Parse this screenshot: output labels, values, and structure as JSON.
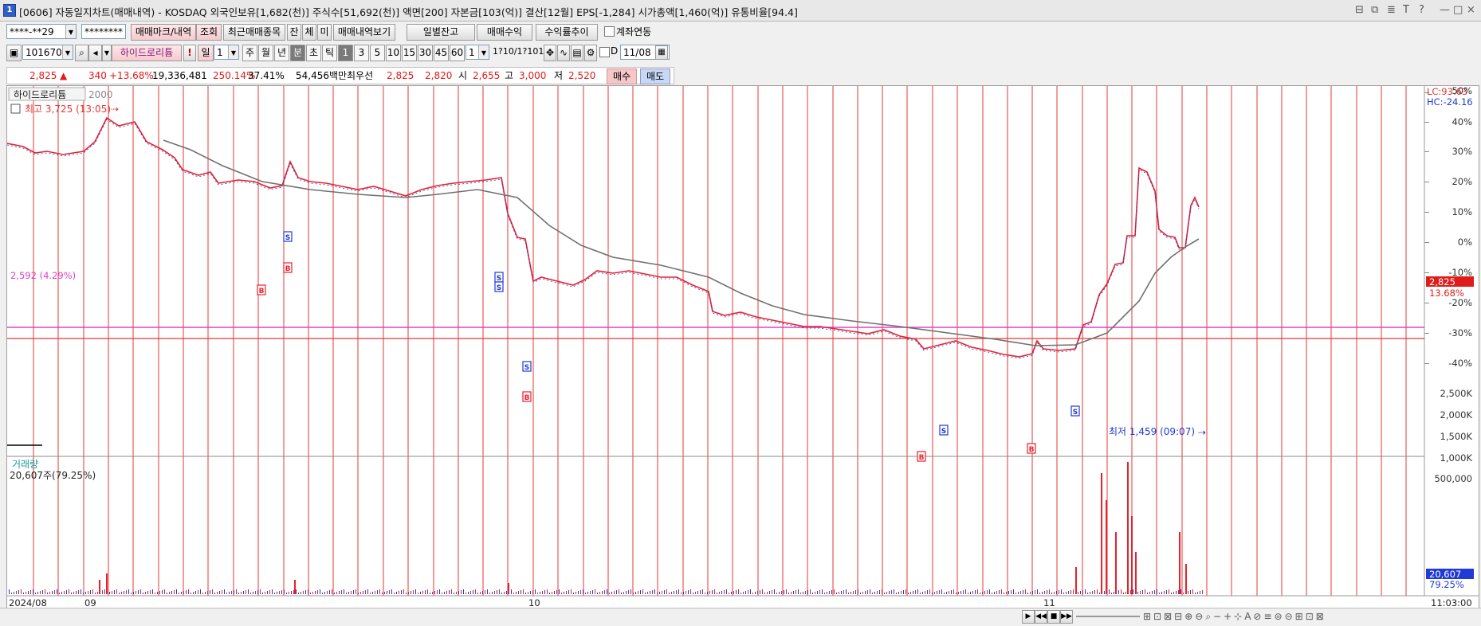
{
  "window": {
    "title": "[0606] 자동일지차트(매매내역) - KOSDAQ 외국인보유[1,682(천)] 주식수[51,692(천)] 액면[200] 자본금[103(억)] 결산[12월] EPS[-1,284] 시가총액[1,460(억)] 유통비율[94.4]",
    "icon_label": "1",
    "controls": [
      "⊟",
      "⧉",
      "≣",
      "T",
      "?",
      "—",
      "□",
      "×"
    ]
  },
  "toolbar1": {
    "account": "****-**29",
    "password": "********",
    "btn_trade_mark": "매매마크/내역",
    "btn_query": "조회",
    "btn_recent": "최근매매종목",
    "btn_jan": "잔",
    "btn_che": "체",
    "btn_mi": "미",
    "btn_history": "매매내역보기",
    "btn_daily_balance": "일별잔고",
    "btn_profit": "매매수익",
    "btn_profit_rate": "수익률추이",
    "chk_account_link": "계좌연동"
  },
  "toolbar2": {
    "code": "101670",
    "stock_name": "하이드로리튬",
    "btn_excl": "!",
    "btn_il": "일",
    "period_count": "1",
    "periods": [
      "주",
      "월",
      "년",
      "분",
      "초",
      "틱"
    ],
    "tick_nums": [
      "1",
      "3",
      "5",
      "10",
      "15",
      "30",
      "45",
      "60"
    ],
    "interval_value": "1",
    "range_label": "1?10/1?101",
    "chk_d": "D",
    "date": "11/08"
  },
  "quote": {
    "price": "2,825",
    "arrow": "▲",
    "change": "340",
    "change_pct": "+13.68%",
    "volume": "19,336,481",
    "vol_ratio": "250.14%",
    "turnover": "37.41%",
    "amount": "54,456백만",
    "best_label": "최우선",
    "ask": "2,825",
    "bid": "2,820",
    "open_label": "시",
    "open": "2,655",
    "high_label": "고",
    "high": "3,000",
    "low_label": "저",
    "low": "2,520",
    "btn_buy": "매수",
    "btn_sell": "매도"
  },
  "chart": {
    "stock_label": "하이드로리튬",
    "count": "2000",
    "high_marker": "최고 3,725 (13:05)",
    "low_marker": "최저 1,459 (09:07)",
    "ref_line_label": "2,592 (4.29%)",
    "lc": "LC:93.63",
    "hc": "HC:-24.16",
    "price_tag": "2,825",
    "price_tag_pct": "13.68%",
    "y_ticks": [
      "50%",
      "40%",
      "30%",
      "20%",
      "10%",
      "0%",
      "-10%",
      "-20%",
      "-30%",
      "-40%"
    ],
    "volume_label": "거래량",
    "volume_value": "20,607주(79.25%)",
    "vol_ticks": [
      "2,500K",
      "2,000K",
      "1,500K",
      "1,000K",
      "500,000"
    ],
    "vol_tag": "20,607",
    "vol_tag_pct": "79.25%",
    "x_labels": [
      "2024/08",
      "09",
      "10",
      "11"
    ],
    "time_label": "11:03:00",
    "colors": {
      "up": "#e8202a",
      "down": "#1f3ad6",
      "ma": "#707070",
      "grid_red": "#e53935",
      "ref_pink": "#e040c8"
    },
    "markers": [
      {
        "type": "B",
        "label": "B"
      },
      {
        "type": "S",
        "label": "S"
      },
      {
        "type": "B",
        "label": "B"
      },
      {
        "type": "S",
        "label": "S"
      },
      {
        "type": "S",
        "label": "S"
      },
      {
        "type": "S",
        "label": "S"
      },
      {
        "type": "B",
        "label": "B"
      },
      {
        "type": "S",
        "label": "S"
      },
      {
        "type": "B",
        "label": "B"
      },
      {
        "type": "B",
        "label": "B"
      },
      {
        "type": "S",
        "label": "S"
      }
    ]
  }
}
